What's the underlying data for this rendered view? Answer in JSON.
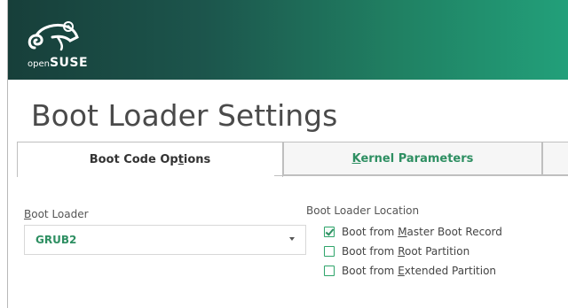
{
  "branding": {
    "logo_prefix": "open",
    "logo_name": "SUSE",
    "accent_color": "#2e8f62",
    "header_gradient": [
      "#173f3a",
      "#22a07a"
    ]
  },
  "page": {
    "title": "Boot Loader Settings"
  },
  "tabs": [
    {
      "pre": "Boot Code Op",
      "mnemonic": "t",
      "post": "ions",
      "active": true
    },
    {
      "pre": "",
      "mnemonic": "K",
      "post": "ernel Parameters",
      "active": false
    }
  ],
  "boot_loader": {
    "label_mnemonic": "B",
    "label_rest": "oot Loader",
    "selected": "GRUB2"
  },
  "location": {
    "title": "Boot Loader Location",
    "options": [
      {
        "pre": "Boot from ",
        "mnemonic": "M",
        "post": "aster Boot Record",
        "checked": true
      },
      {
        "pre": "Boot from ",
        "mnemonic": "R",
        "post": "oot Partition",
        "checked": false
      },
      {
        "pre": "Boot from ",
        "mnemonic": "E",
        "post": "xtended Partition",
        "checked": false
      }
    ]
  },
  "icons": {
    "logo": "chameleon-logo-icon",
    "dropdown": "chevron-down-icon",
    "checkbox": "checkbox-icon"
  }
}
